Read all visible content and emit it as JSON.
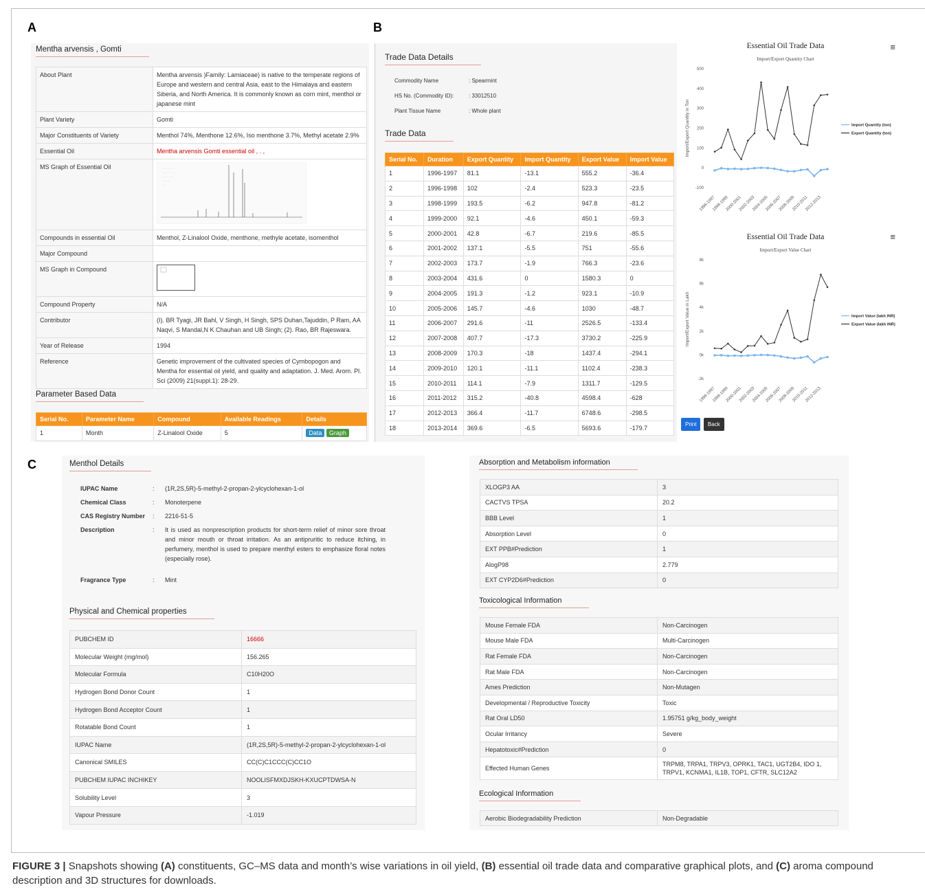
{
  "panel_labels": {
    "a": "A",
    "b": "B",
    "c": "C"
  },
  "panel_a": {
    "title": "Mentha arvensis , Gomti",
    "rows": [
      {
        "k": "About Plant",
        "v": "Mentha arvensis )Family: Lamiaceae) is native to the temperate regions of Europe and western and central Asia, east to the Himalaya and eastern Siberia, and North America. It is commonly known as corn mint, menthol or japanese mint"
      },
      {
        "k": "Plant Variety",
        "v": "Gomti"
      },
      {
        "k": "Major Constituents of Variety",
        "v": "Menthol 74%, Menthone 12.6%, Iso menthone 3.7%, Methyl acetate 2.9%"
      },
      {
        "k": "Essential Oil",
        "v": "Mentha arvensis Gomti essential oil , . ,"
      },
      {
        "k": "MS Graph of Essential Oil",
        "v": ""
      },
      {
        "k": "Compounds in essential Oil",
        "v": "Menthol, Z-Linalool Oxide, menthone, methyle acetate, isomenthol"
      },
      {
        "k": "Major Compound",
        "v": ""
      },
      {
        "k": "MS Graph in Compound",
        "v": ""
      },
      {
        "k": "Compound Property",
        "v": "N/A"
      },
      {
        "k": "Contributor",
        "v": "(I). BR Tyagi, JR Bahl, V Singh, H Singh, SPS Duhan,Tajuddin, P Ram, AA Naqvi, S Mandal,N K Chauhan and UB Singh; (2). Rao, BR Rajeswara."
      },
      {
        "k": "Year of Release",
        "v": "1994"
      },
      {
        "k": "Reference",
        "v": "Genetic improvement of the cultivated species of Cymbopogon and Mentha for essential oil yield, and quality and adaptation. J. Med. Arom. Pl. Sci (2009) 21(suppl.1): 28-29."
      }
    ],
    "param_title": "Parameter Based Data",
    "param_headers": [
      "Serial No.",
      "Parameter Name",
      "Compound",
      "Available Readings",
      "Details"
    ],
    "param_row": {
      "serial": "1",
      "name": "Month",
      "compound": "Z-Linalool Oxide",
      "readings": "5",
      "btn_data": "Data",
      "btn_graph": "Graph"
    }
  },
  "panel_b": {
    "details_title": "Trade Data Details",
    "details": [
      {
        "k": "Commodity Name",
        "v": ": Spearmint"
      },
      {
        "k": "HS No. (Commodity ID):",
        "v": ": 33012510"
      },
      {
        "k": "Plant Tissue Name",
        "v": ": Whole plant"
      }
    ],
    "trade_title": "Trade Data",
    "headers": [
      "Serial No.",
      "Duration",
      "Export Quantity",
      "Import Quantity",
      "Export Value",
      "Import Value"
    ],
    "rows": [
      [
        "1",
        "1996-1997",
        "81.1",
        "-13.1",
        "555.2",
        "-36.4"
      ],
      [
        "2",
        "1996-1998",
        "102",
        "-2.4",
        "523.3",
        "-23.5"
      ],
      [
        "3",
        "1998-1999",
        "193.5",
        "-6.2",
        "947.8",
        "-81.2"
      ],
      [
        "4",
        "1999-2000",
        "92.1",
        "-4.6",
        "450.1",
        "-59.3"
      ],
      [
        "5",
        "2000-2001",
        "42.8",
        "-6.7",
        "219.6",
        "-85.5"
      ],
      [
        "6",
        "2001-2002",
        "137.1",
        "-5.5",
        "751",
        "-55.6"
      ],
      [
        "7",
        "2002-2003",
        "173.7",
        "-1.9",
        "766.3",
        "-23.6"
      ],
      [
        "8",
        "2003-2004",
        "431.6",
        "0",
        "1580.3",
        "0"
      ],
      [
        "9",
        "2004-2005",
        "191.3",
        "-1.2",
        "923.1",
        "-10.9"
      ],
      [
        "10",
        "2005-2006",
        "145.7",
        "-4.6",
        "1030",
        "-48.7"
      ],
      [
        "11",
        "2006-2007",
        "291.6",
        "-11",
        "2526.5",
        "-133.4"
      ],
      [
        "12",
        "2007-2008",
        "407.7",
        "-17.3",
        "3730.2",
        "-225.9"
      ],
      [
        "13",
        "2008-2009",
        "170.3",
        "-18",
        "1437.4",
        "-294.1"
      ],
      [
        "14",
        "2009-2010",
        "120.1",
        "-11.1",
        "1102.4",
        "-238.3"
      ],
      [
        "15",
        "2010-2011",
        "114.1",
        "-7.9",
        "1311.7",
        "-129.5"
      ],
      [
        "16",
        "2011-2012",
        "315.2",
        "-40.8",
        "4598.4",
        "-628"
      ],
      [
        "17",
        "2012-2013",
        "366.4",
        "-11.7",
        "6748.6",
        "-298.5"
      ],
      [
        "18",
        "2013-2014",
        "369.6",
        "-6.5",
        "5693.6",
        "-179.7"
      ]
    ],
    "print_label": "Print",
    "back_label": "Back",
    "menu_icon": "≡"
  },
  "chart_data": [
    {
      "type": "line",
      "title": "Essential Oil Trade Data",
      "subtitle": "Import/Export Quantity Chart",
      "ylabel": "Import/Export Quantity in Ton",
      "xlabel": "",
      "ylim": [
        -100,
        500
      ],
      "yticks": [
        "500",
        "400",
        "300",
        "200",
        "100",
        "0",
        "-100"
      ],
      "x_tick_labels": [
        "1996-1997",
        "1998-1999",
        "2000-2001",
        "2002-2003",
        "2004-2005",
        "2006-2007",
        "2008-2009",
        "2010-2011",
        "2012-2013"
      ],
      "legend_position": "right",
      "series": [
        {
          "name": "Import Quantity (ton)",
          "color": "#7cb5ec",
          "values": [
            -13.1,
            -2.4,
            -6.2,
            -4.6,
            -6.7,
            -5.5,
            -1.9,
            0,
            -1.2,
            -4.6,
            -11,
            -17.3,
            -18,
            -11.1,
            -7.9,
            -40.8,
            -11.7,
            -6.5
          ]
        },
        {
          "name": "Export Quantity (ton)",
          "color": "#333333",
          "values": [
            81.1,
            102,
            193.5,
            92.1,
            42.8,
            137.1,
            173.7,
            431.6,
            191.3,
            145.7,
            291.6,
            407.7,
            170.3,
            120.1,
            114.1,
            315.2,
            366.4,
            369.6
          ]
        }
      ]
    },
    {
      "type": "line",
      "title": "Essential Oil Trade Data",
      "subtitle": "Import/Export Value Chart",
      "ylabel": "Import/Export Value in Lakh",
      "xlabel": "",
      "ylim": [
        -2000,
        8000
      ],
      "yticks": [
        "8k",
        "6k",
        "4k",
        "2k",
        "0k",
        "-2k"
      ],
      "x_tick_labels": [
        "1996-1997",
        "1998-1999",
        "2000-2001",
        "2002-2003",
        "2004-2005",
        "2006-2007",
        "2008-2009",
        "2010-2011",
        "2012-2013"
      ],
      "legend_position": "right",
      "series": [
        {
          "name": "Import Value (lakh INR)",
          "color": "#7cb5ec",
          "values": [
            -36.4,
            -23.5,
            -81.2,
            -59.3,
            -85.5,
            -55.6,
            -23.6,
            0,
            -10.9,
            -48.7,
            -133.4,
            -225.9,
            -294.1,
            -238.3,
            -129.5,
            -628,
            -298.5,
            -179.7
          ]
        },
        {
          "name": "Export Value (lakh INR)",
          "color": "#333333",
          "values": [
            555.2,
            523.3,
            947.8,
            450.1,
            219.6,
            751,
            766.3,
            1580.3,
            923.1,
            1030,
            2526.5,
            3730.2,
            1437.4,
            1102.4,
            1311.7,
            4598.4,
            6748.6,
            5693.6
          ]
        }
      ]
    }
  ],
  "panel_c": {
    "menthol_title": "Menthol Details",
    "details": [
      {
        "k": "IUPAC Name",
        "v": "(1R,2S,5R)-5-methyl-2-propan-2-ylcyclohexan-1-ol"
      },
      {
        "k": "Chemical Class",
        "v": "Monoterpene"
      },
      {
        "k": "CAS Registry Number",
        "v": "2216-51-5"
      },
      {
        "k": "Description",
        "v": "It is used as nonprescription products for short-term relief of minor sore throat and minor mouth or throat irritation. As an antipruritic to reduce itching, in perfumery, menthol is used to prepare menthyl esters to emphasize floral notes (especially rose)."
      },
      {
        "k": "Fragrance Type",
        "v": "Mint"
      }
    ],
    "colon": ":",
    "phys_title": "Physical and Chemical properties",
    "phys": [
      {
        "k": "PUBCHEM ID",
        "v": "16666"
      },
      {
        "k": "Molecular Weight (mg/mol)",
        "v": "156.265"
      },
      {
        "k": "Molecular Formula",
        "v": "C10H20O"
      },
      {
        "k": "Hydrogen Bond Donor Count",
        "v": "1"
      },
      {
        "k": "Hydrogen Bond Acceptor Count",
        "v": "1"
      },
      {
        "k": "Rotatable Bond Count",
        "v": "1"
      },
      {
        "k": "IUPAC Name",
        "v": "(1R,2S,5R)-5-methyl-2-propan-2-ylcyclohexan-1-ol"
      },
      {
        "k": "Canonical SMILES",
        "v": "CC(C)C1CCC(C)CC1O"
      },
      {
        "k": "PUBCHEM IUPAC INCHIKEY",
        "v": "NOOLISFMXDJSKH-KXUCPTDWSA-N"
      },
      {
        "k": "Solubility Level",
        "v": "3"
      },
      {
        "k": "Vapour Pressure",
        "v": "-1.019"
      }
    ],
    "abs_title": "Absorption and Metabolism information",
    "abs": [
      {
        "k": "XLOGP3 AA",
        "v": "3"
      },
      {
        "k": "CACTVS TPSA",
        "v": "20.2"
      },
      {
        "k": "BBB Level",
        "v": "1"
      },
      {
        "k": "Absorption Level",
        "v": "0"
      },
      {
        "k": "EXT PPB#Prediction",
        "v": "1"
      },
      {
        "k": "AlogP98",
        "v": "2.779"
      },
      {
        "k": "EXT CYP2D6#Prediction",
        "v": "0"
      }
    ],
    "tox_title": "Toxicological Information",
    "tox": [
      {
        "k": "Mouse Female FDA",
        "v": "Non-Carcinogen"
      },
      {
        "k": "Mouse Male FDA",
        "v": "Multi-Carcinogen"
      },
      {
        "k": "Rat Female FDA",
        "v": "Non-Carcinogen"
      },
      {
        "k": "Rat Male FDA",
        "v": "Non-Carcinogen"
      },
      {
        "k": "Ames Prediction",
        "v": "Non-Mutagen"
      },
      {
        "k": "Developmental / Reproductive Toxicity",
        "v": "Toxic"
      },
      {
        "k": "Rat Oral LD50",
        "v": "1.95751 g/kg_body_weight"
      },
      {
        "k": "Ocular Irritancy",
        "v": "Severe"
      },
      {
        "k": "Hepatotoxic#Prediction",
        "v": "0"
      },
      {
        "k": "Effected Human Genes",
        "v": "TRPM8, TRPA1, TRPV3, OPRK1, TAC1, UGT2B4, IDO 1, TRPV1, KCNMA1, IL1B, TOP1, CFTR, SLC12A2"
      }
    ],
    "eco_title": "Ecological Information",
    "eco": [
      {
        "k": "Aerobic Biodegradability Prediction",
        "v": "Non-Degradable"
      }
    ]
  },
  "caption": {
    "fig": "FIGURE 3 |",
    "t1": " Snapshots showing ",
    "a": "(A)",
    "t2": " constituents, GC–MS data and month’s wise variations in oil yield, ",
    "b": "(B)",
    "t3": " essential oil trade data and comparative graphical plots, and ",
    "c": "(C)",
    "t4": " aroma compound description and 3D structures for downloads."
  }
}
